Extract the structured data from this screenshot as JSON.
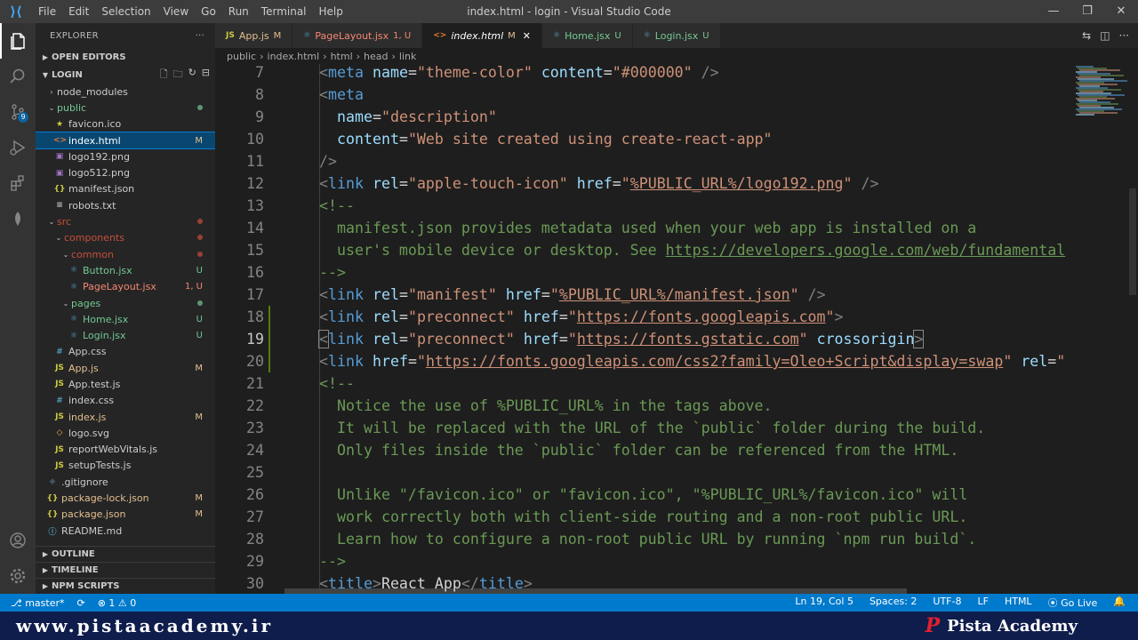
{
  "window": {
    "title": "index.html - login - Visual Studio Code",
    "menu": [
      "File",
      "Edit",
      "Selection",
      "View",
      "Go",
      "Run",
      "Terminal",
      "Help"
    ],
    "controls": [
      "—",
      "❐",
      "✕"
    ]
  },
  "activity": {
    "scm_badge": "9"
  },
  "sidebar": {
    "title": "EXPLORER",
    "open_editors": "OPEN EDITORS",
    "project": "LOGIN",
    "tree": [
      {
        "label": "node_modules",
        "depth": 1,
        "type": "folder",
        "open": false,
        "status": "",
        "status_color": ""
      },
      {
        "label": "public",
        "depth": 1,
        "type": "folder",
        "open": true,
        "status": "dot",
        "status_color": "#73c991"
      },
      {
        "label": "favicon.ico",
        "depth": 2,
        "type": "ico",
        "status": "",
        "status_color": ""
      },
      {
        "label": "index.html",
        "depth": 2,
        "type": "html",
        "status": "M",
        "status_color": "#e2c08d",
        "selected": true
      },
      {
        "label": "logo192.png",
        "depth": 2,
        "type": "img",
        "status": "",
        "status_color": ""
      },
      {
        "label": "logo512.png",
        "depth": 2,
        "type": "img",
        "status": "",
        "status_color": ""
      },
      {
        "label": "manifest.json",
        "depth": 2,
        "type": "json",
        "status": "",
        "status_color": ""
      },
      {
        "label": "robots.txt",
        "depth": 2,
        "type": "txt",
        "status": "",
        "status_color": ""
      },
      {
        "label": "src",
        "depth": 1,
        "type": "folder",
        "open": true,
        "status": "dot",
        "status_color": "#c74e39"
      },
      {
        "label": "components",
        "depth": 2,
        "type": "folder",
        "open": true,
        "status": "dot",
        "status_color": "#c74e39"
      },
      {
        "label": "common",
        "depth": 3,
        "type": "folder",
        "open": true,
        "status": "dot",
        "status_color": "#c74e39"
      },
      {
        "label": "Button.jsx",
        "depth": 4,
        "type": "jsx",
        "status": "U",
        "status_color": "#73c991"
      },
      {
        "label": "PageLayout.jsx",
        "depth": 4,
        "type": "jsx",
        "status": "1, U",
        "status_color": "#f48771"
      },
      {
        "label": "pages",
        "depth": 3,
        "type": "folder",
        "open": true,
        "status": "dot",
        "status_color": "#73c991"
      },
      {
        "label": "Home.jsx",
        "depth": 4,
        "type": "jsx",
        "status": "U",
        "status_color": "#73c991"
      },
      {
        "label": "Login.jsx",
        "depth": 4,
        "type": "jsx",
        "status": "U",
        "status_color": "#73c991"
      },
      {
        "label": "App.css",
        "depth": 2,
        "type": "css",
        "status": "",
        "status_color": ""
      },
      {
        "label": "App.js",
        "depth": 2,
        "type": "js",
        "status": "M",
        "status_color": "#e2c08d"
      },
      {
        "label": "App.test.js",
        "depth": 2,
        "type": "js",
        "status": "",
        "status_color": ""
      },
      {
        "label": "index.css",
        "depth": 2,
        "type": "css",
        "status": "",
        "status_color": ""
      },
      {
        "label": "index.js",
        "depth": 2,
        "type": "js",
        "status": "M",
        "status_color": "#e2c08d"
      },
      {
        "label": "logo.svg",
        "depth": 2,
        "type": "svg",
        "status": "",
        "status_color": ""
      },
      {
        "label": "reportWebVitals.js",
        "depth": 2,
        "type": "js",
        "status": "",
        "status_color": ""
      },
      {
        "label": "setupTests.js",
        "depth": 2,
        "type": "js",
        "status": "",
        "status_color": ""
      },
      {
        "label": ".gitignore",
        "depth": 1,
        "type": "git",
        "status": "",
        "status_color": ""
      },
      {
        "label": "package-lock.json",
        "depth": 1,
        "type": "json",
        "status": "M",
        "status_color": "#e2c08d"
      },
      {
        "label": "package.json",
        "depth": 1,
        "type": "json",
        "status": "M",
        "status_color": "#e2c08d"
      },
      {
        "label": "README.md",
        "depth": 1,
        "type": "md",
        "status": "",
        "status_color": ""
      }
    ],
    "bottom_sections": [
      "OUTLINE",
      "TIMELINE",
      "NPM SCRIPTS"
    ]
  },
  "tabs": [
    {
      "label": "App.js",
      "status": "M",
      "icon": "JS",
      "icon_color": "#cbcb41",
      "status_color": "#e2c08d",
      "active": false
    },
    {
      "label": "PageLayout.jsx",
      "status": "1, U",
      "icon": "⚛",
      "icon_color": "#519aba",
      "status_color": "#f48771",
      "active": false
    },
    {
      "label": "index.html",
      "status": "M",
      "icon": "<>",
      "icon_color": "#e37933",
      "status_color": "#e2c08d",
      "active": true
    },
    {
      "label": "Home.jsx",
      "status": "U",
      "icon": "⚛",
      "icon_color": "#519aba",
      "status_color": "#73c991",
      "active": false
    },
    {
      "label": "Login.jsx",
      "status": "U",
      "icon": "⚛",
      "icon_color": "#519aba",
      "status_color": "#73c991",
      "active": false
    }
  ],
  "breadcrumb": [
    "public",
    "›",
    "index.html",
    "›",
    "html",
    "›",
    "head",
    "›",
    "link"
  ],
  "code": [
    {
      "n": "7",
      "ind": 1,
      "tokens": [
        [
          "br",
          "<"
        ],
        [
          "tag",
          "meta"
        ],
        [
          "txt",
          " "
        ],
        [
          "attr",
          "name"
        ],
        [
          "txt",
          "="
        ],
        [
          "str",
          "\"theme-color\""
        ],
        [
          "txt",
          " "
        ],
        [
          "attr",
          "content"
        ],
        [
          "txt",
          "="
        ],
        [
          "str",
          "\"#000000\""
        ],
        [
          "txt",
          " "
        ],
        [
          "br",
          "/>"
        ]
      ]
    },
    {
      "n": "8",
      "ind": 1,
      "tokens": [
        [
          "br",
          "<"
        ],
        [
          "tag",
          "meta"
        ]
      ]
    },
    {
      "n": "9",
      "ind": 2,
      "tokens": [
        [
          "attr",
          "name"
        ],
        [
          "txt",
          "="
        ],
        [
          "str",
          "\"description\""
        ]
      ]
    },
    {
      "n": "10",
      "ind": 2,
      "tokens": [
        [
          "attr",
          "content"
        ],
        [
          "txt",
          "="
        ],
        [
          "str",
          "\"Web site created using create-react-app\""
        ]
      ]
    },
    {
      "n": "11",
      "ind": 1,
      "tokens": [
        [
          "br",
          "/>"
        ]
      ]
    },
    {
      "n": "12",
      "ind": 1,
      "tokens": [
        [
          "br",
          "<"
        ],
        [
          "tag",
          "link"
        ],
        [
          "txt",
          " "
        ],
        [
          "attr",
          "rel"
        ],
        [
          "txt",
          "="
        ],
        [
          "str",
          "\"apple-touch-icon\""
        ],
        [
          "txt",
          " "
        ],
        [
          "attr",
          "href"
        ],
        [
          "txt",
          "="
        ],
        [
          "str",
          "\""
        ],
        [
          "link",
          "%PUBLIC_URL%/logo192.png"
        ],
        [
          "str",
          "\""
        ],
        [
          "txt",
          " "
        ],
        [
          "br",
          "/>"
        ]
      ]
    },
    {
      "n": "13",
      "ind": 1,
      "tokens": [
        [
          "cmt",
          "<!--"
        ]
      ]
    },
    {
      "n": "14",
      "ind": 2,
      "tokens": [
        [
          "cmt",
          "manifest.json provides metadata used when your web app is installed on a"
        ]
      ]
    },
    {
      "n": "15",
      "ind": 2,
      "tokens": [
        [
          "cmt",
          "user's mobile device or desktop. See "
        ],
        [
          "clink",
          "https://developers.google.com/web/fundamental"
        ]
      ]
    },
    {
      "n": "16",
      "ind": 1,
      "tokens": [
        [
          "cmt",
          "-->"
        ]
      ]
    },
    {
      "n": "17",
      "ind": 1,
      "tokens": [
        [
          "br",
          "<"
        ],
        [
          "tag",
          "link"
        ],
        [
          "txt",
          " "
        ],
        [
          "attr",
          "rel"
        ],
        [
          "txt",
          "="
        ],
        [
          "str",
          "\"manifest\""
        ],
        [
          "txt",
          " "
        ],
        [
          "attr",
          "href"
        ],
        [
          "txt",
          "="
        ],
        [
          "str",
          "\""
        ],
        [
          "link",
          "%PUBLIC_URL%/manifest.json"
        ],
        [
          "str",
          "\""
        ],
        [
          "txt",
          " "
        ],
        [
          "br",
          "/>"
        ]
      ]
    },
    {
      "n": "18",
      "ind": 1,
      "git": true,
      "tokens": [
        [
          "br",
          "<"
        ],
        [
          "tag",
          "link"
        ],
        [
          "txt",
          " "
        ],
        [
          "attr",
          "rel"
        ],
        [
          "txt",
          "="
        ],
        [
          "str",
          "\"preconnect\""
        ],
        [
          "txt",
          " "
        ],
        [
          "attr",
          "href"
        ],
        [
          "txt",
          "="
        ],
        [
          "str",
          "\""
        ],
        [
          "link",
          "https://fonts.googleapis.com"
        ],
        [
          "str",
          "\""
        ],
        [
          "br",
          ">"
        ]
      ]
    },
    {
      "n": "19",
      "ind": 1,
      "git": true,
      "current": true,
      "tokens": [
        [
          "brc",
          "<"
        ],
        [
          "tag",
          "link"
        ],
        [
          "txt",
          " "
        ],
        [
          "attr",
          "rel"
        ],
        [
          "txt",
          "="
        ],
        [
          "str",
          "\"preconnect\""
        ],
        [
          "txt",
          " "
        ],
        [
          "attr",
          "href"
        ],
        [
          "txt",
          "="
        ],
        [
          "str",
          "\""
        ],
        [
          "link",
          "https://fonts.gstatic.com"
        ],
        [
          "str",
          "\""
        ],
        [
          "txt",
          " "
        ],
        [
          "attr",
          "crossorigin"
        ],
        [
          "brc",
          ">"
        ]
      ]
    },
    {
      "n": "20",
      "ind": 1,
      "git": true,
      "tokens": [
        [
          "br",
          "<"
        ],
        [
          "tag",
          "link"
        ],
        [
          "txt",
          " "
        ],
        [
          "attr",
          "href"
        ],
        [
          "txt",
          "="
        ],
        [
          "str",
          "\""
        ],
        [
          "link",
          "https://fonts.googleapis.com/css2?family=Oleo+Script&display=swap"
        ],
        [
          "str",
          "\""
        ],
        [
          "txt",
          " "
        ],
        [
          "attr",
          "rel"
        ],
        [
          "txt",
          "="
        ],
        [
          "str",
          "\""
        ]
      ]
    },
    {
      "n": "21",
      "ind": 1,
      "tokens": [
        [
          "cmt",
          "<!--"
        ]
      ]
    },
    {
      "n": "22",
      "ind": 2,
      "tokens": [
        [
          "cmt",
          "Notice the use of %PUBLIC_URL% in the tags above."
        ]
      ]
    },
    {
      "n": "23",
      "ind": 2,
      "tokens": [
        [
          "cmt",
          "It will be replaced with the URL of the `public` folder during the build."
        ]
      ]
    },
    {
      "n": "24",
      "ind": 2,
      "tokens": [
        [
          "cmt",
          "Only files inside the `public` folder can be referenced from the HTML."
        ]
      ]
    },
    {
      "n": "25",
      "ind": 2,
      "tokens": []
    },
    {
      "n": "26",
      "ind": 2,
      "tokens": [
        [
          "cmt",
          "Unlike \"/favicon.ico\" or \"favicon.ico\", \"%PUBLIC_URL%/favicon.ico\" will"
        ]
      ]
    },
    {
      "n": "27",
      "ind": 2,
      "tokens": [
        [
          "cmt",
          "work correctly both with client-side routing and a non-root public URL."
        ]
      ]
    },
    {
      "n": "28",
      "ind": 2,
      "tokens": [
        [
          "cmt",
          "Learn how to configure a non-root public URL by running `npm run build`."
        ]
      ]
    },
    {
      "n": "29",
      "ind": 1,
      "tokens": [
        [
          "cmt",
          "-->"
        ]
      ]
    },
    {
      "n": "30",
      "ind": 1,
      "tokens": [
        [
          "br",
          "<"
        ],
        [
          "tag",
          "title"
        ],
        [
          "br",
          ">"
        ],
        [
          "txt",
          "React App"
        ],
        [
          "br",
          "</"
        ],
        [
          "tag",
          "title"
        ],
        [
          "br",
          ">"
        ]
      ]
    }
  ],
  "statusbar": {
    "branch": "master*",
    "sync": "⟳",
    "problems": "⊗ 1 ⚠ 0",
    "position": "Ln 19, Col 5",
    "spaces": "Spaces: 2",
    "encoding": "UTF-8",
    "eol": "LF",
    "language": "HTML",
    "golive": "Go Live",
    "bell": "🔔"
  },
  "watermark": {
    "url": "www.pistaacademy.ir",
    "brand": "Pista Academy",
    "brand_mark": "P"
  }
}
